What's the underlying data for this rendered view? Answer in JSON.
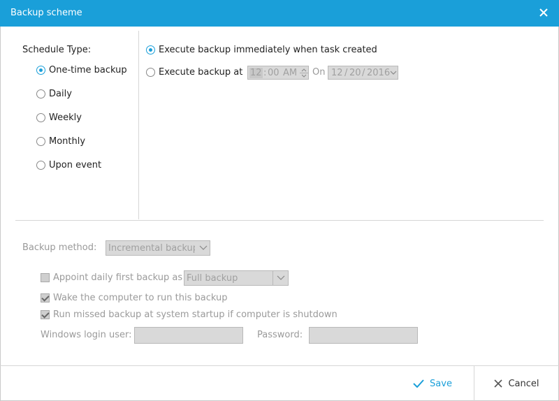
{
  "window": {
    "title": "Backup scheme"
  },
  "schedule": {
    "label": "Schedule Type:",
    "options": [
      "One-time backup",
      "Daily",
      "Weekly",
      "Monthly",
      "Upon event"
    ],
    "selected": "One-time backup"
  },
  "execute": {
    "immediately_label": "Execute backup immediately when task created",
    "at_label": "Execute backup at",
    "time_hour": "12",
    "time_minute": "00",
    "time_ampm": "AM",
    "on_label": "On",
    "date_month": "12",
    "date_day": "20",
    "date_year": "2016"
  },
  "method": {
    "label": "Backup method:",
    "value": "Incremental backup"
  },
  "options": {
    "appoint_label": "Appoint daily first backup as",
    "appoint_value": "Full backup",
    "appoint_checked": false,
    "wake_label": "Wake the computer to run this backup",
    "wake_checked": true,
    "missed_label": "Run missed backup at system startup if computer is shutdown",
    "missed_checked": true,
    "login_user_label": "Windows login user:",
    "login_user_value": "",
    "password_label": "Password:",
    "password_value": ""
  },
  "footer": {
    "save_label": "Save",
    "cancel_label": "Cancel"
  },
  "colors": {
    "accent": "#1a9fd9"
  }
}
